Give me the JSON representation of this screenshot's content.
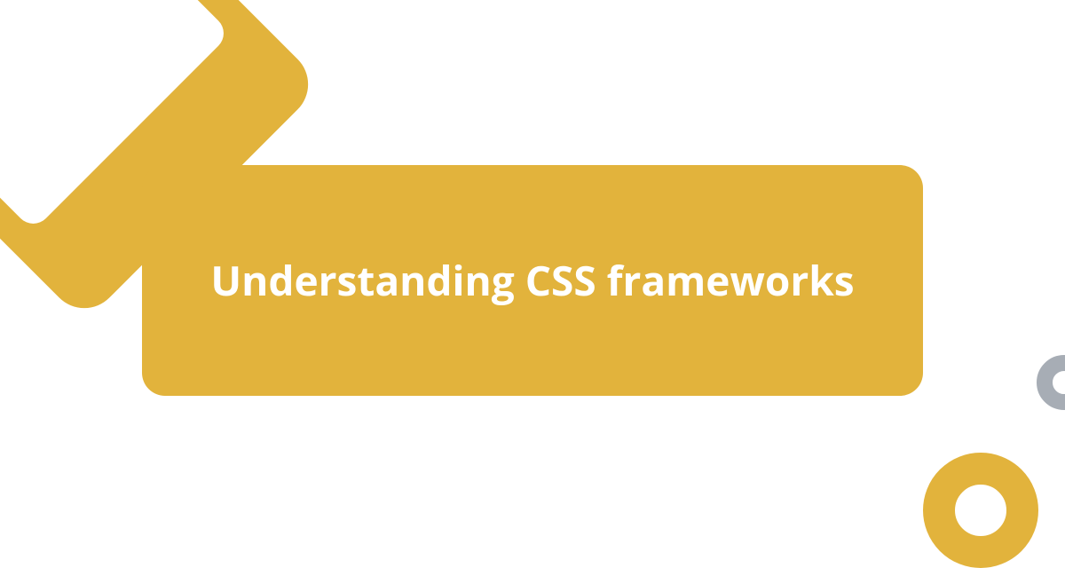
{
  "title": "Understanding CSS frameworks",
  "colors": {
    "primary": "#e2b33c",
    "secondary": "#a7adb5",
    "background": "#ffffff",
    "text": "#ffffff"
  }
}
